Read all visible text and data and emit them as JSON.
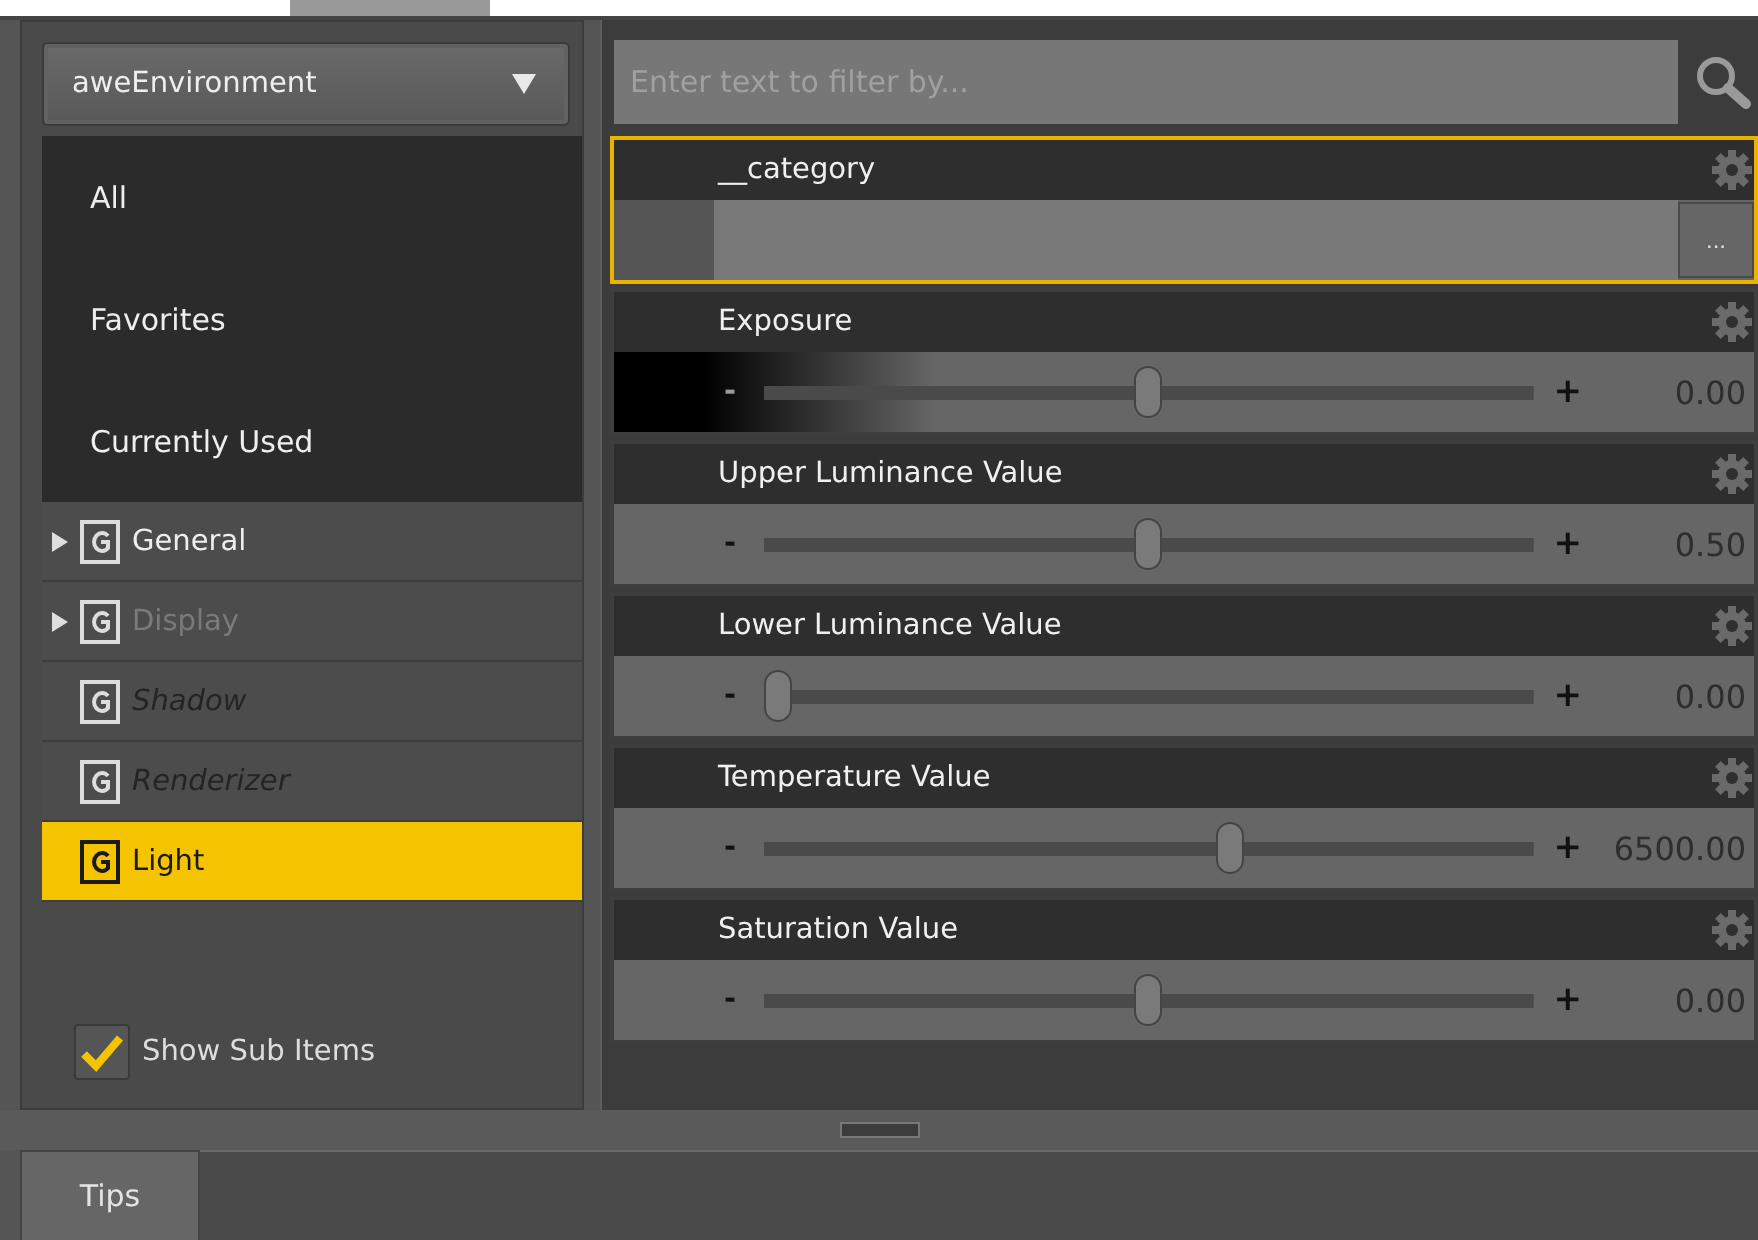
{
  "preset_dropdown": {
    "value": "aweEnvironment"
  },
  "categories": [
    {
      "kind": "filter",
      "label": "All",
      "selected": false
    },
    {
      "kind": "filter",
      "label": "Favorites",
      "selected": false
    },
    {
      "kind": "filter",
      "label": "Currently Used",
      "selected": false
    },
    {
      "kind": "group",
      "label": "General",
      "expandable": true,
      "inactive": false,
      "unused": false,
      "selected": false
    },
    {
      "kind": "group",
      "label": "Display",
      "expandable": true,
      "inactive": true,
      "unused": false,
      "selected": false
    },
    {
      "kind": "group",
      "label": "Shadow",
      "expandable": false,
      "inactive": false,
      "unused": true,
      "selected": false
    },
    {
      "kind": "group",
      "label": "Renderizer",
      "expandable": false,
      "inactive": false,
      "unused": true,
      "selected": false
    },
    {
      "kind": "group",
      "label": "Light",
      "expandable": false,
      "inactive": false,
      "unused": false,
      "selected": true
    }
  ],
  "show_sub_items": {
    "label": "Show Sub Items",
    "checked": true
  },
  "filter": {
    "placeholder": "Enter text to filter by..."
  },
  "properties": [
    {
      "kind": "text",
      "label": "__category",
      "selected": true,
      "button": "..."
    },
    {
      "kind": "slider",
      "label": "Exposure",
      "selected": false,
      "gradient": true,
      "minus": "-",
      "plus": "+",
      "level": 0.5,
      "value": "0.00"
    },
    {
      "kind": "slider",
      "label": "Upper Luminance Value",
      "selected": false,
      "gradient": false,
      "minus": "-",
      "plus": "+",
      "level": 0.5,
      "value": "0.50"
    },
    {
      "kind": "slider",
      "label": "Lower Luminance Value",
      "selected": false,
      "gradient": false,
      "minus": "-",
      "plus": "+",
      "level": 0,
      "value": "0.00"
    },
    {
      "kind": "slider",
      "label": "Temperature Value",
      "selected": false,
      "gradient": false,
      "minus": "-",
      "plus": "+",
      "level": 0.61,
      "value": "6500.00"
    },
    {
      "kind": "slider",
      "label": "Saturation Value",
      "selected": false,
      "gradient": false,
      "minus": "-",
      "plus": "+",
      "level": 0.5,
      "value": "0.00"
    }
  ],
  "bottom_tabs": [
    {
      "label": "Tips",
      "selected": true
    }
  ]
}
